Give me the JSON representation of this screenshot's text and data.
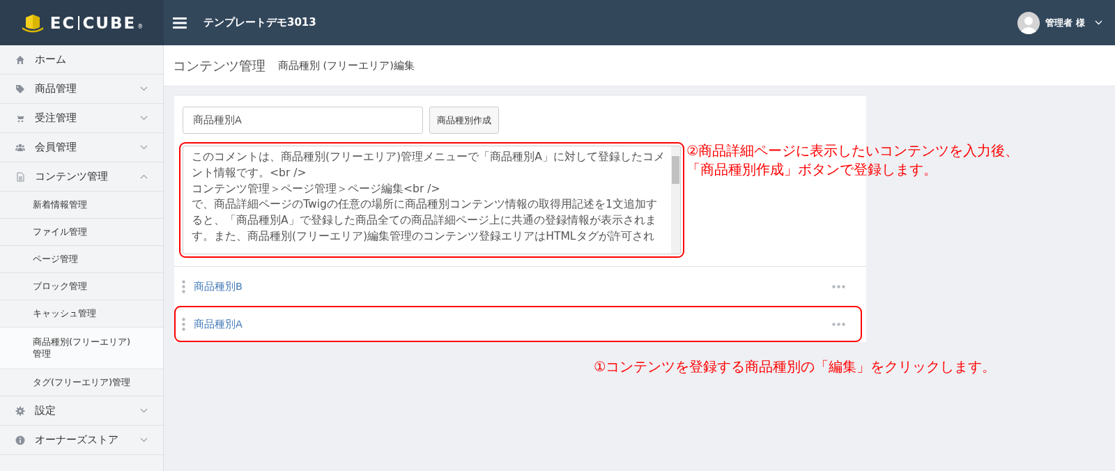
{
  "header": {
    "logo": {
      "left": "EC",
      "right": "CUBE",
      "mark": "®"
    },
    "shop_name": "テンプレートデモ3013",
    "user": "管理者 様"
  },
  "sidebar": {
    "items": [
      {
        "kind": "top",
        "label": "ホーム"
      },
      {
        "kind": "top",
        "label": "商品管理",
        "expanded": false
      },
      {
        "kind": "top",
        "label": "受注管理",
        "expanded": false
      },
      {
        "kind": "top",
        "label": "会員管理",
        "expanded": false
      },
      {
        "kind": "top",
        "label": "コンテンツ管理",
        "expanded": true,
        "children": [
          {
            "label": "新着情報管理",
            "selected": false
          },
          {
            "label": "ファイル管理",
            "selected": false
          },
          {
            "label": "ページ管理",
            "selected": false
          },
          {
            "label": "ブロック管理",
            "selected": false
          },
          {
            "label": "キャッシュ管理",
            "selected": false
          },
          {
            "label": "商品種別(フリーエリア)管理",
            "selected": true
          },
          {
            "label": "タグ(フリーエリア)管理",
            "selected": false
          }
        ]
      },
      {
        "kind": "top",
        "label": "設定",
        "expanded": false
      },
      {
        "kind": "top",
        "label": "オーナーズストア",
        "expanded": false
      }
    ]
  },
  "page_title": {
    "main": "コンテンツ管理",
    "sub": "商品種別 (フリーエリア)編集"
  },
  "editor": {
    "name_value": "商品種別A",
    "create_button": "商品種別作成",
    "highlighted": true,
    "content_lines": [
      "このコメントは、商品種別(フリーエリア)管理メニューで「商品種別A」に対して登録したコメント情報です。<br />",
      "コンテンツ管理＞ページ管理＞ページ編集<br />",
      "で、商品詳細ページのTwigの任意の場所に商品種別コンテンツ情報の取得用記述を1文追加すると、「商品種別A」で登録した商品全ての商品詳細ページ上に共通の登録情報が表示されます。また、商品種別(フリーエリア)編集管理のコンテンツ登録エリアはHTMLタグが許可され"
    ]
  },
  "rows": [
    {
      "label": "商品種別B",
      "highlighted": false
    },
    {
      "label": "商品種別A",
      "highlighted": true
    }
  ],
  "annotations": {
    "editor_note": [
      "②商品詳細ページに表示したいコンテンツを入力後、",
      "「商品種別作成」ボタンで登録します。"
    ],
    "row_note": "①コンテンツを登録する商品種別の「編集」をクリックします。"
  }
}
